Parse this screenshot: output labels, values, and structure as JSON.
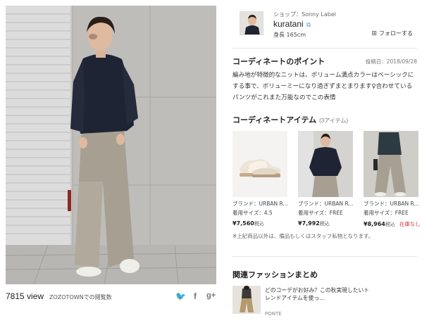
{
  "photo": {
    "alt": "woman in navy knit sweater and wide pants"
  },
  "stats": {
    "view_count": "7815 view",
    "view_note": "ZOZOTOWNでの閲覧数",
    "share_twitter_icon": "twitter-icon",
    "share_facebook_icon": "facebook-icon",
    "share_gplus_icon": "google-plus-icon",
    "share_twitter_glyph": "🐦",
    "share_facebook_glyph": "f",
    "share_gplus_glyph": "g+"
  },
  "profile": {
    "shop": "ショップ：Sonny Label",
    "name": "kuratani",
    "height": "身長 165cm",
    "follow_label": "フォローする"
  },
  "point": {
    "title": "コーディネートのポイント",
    "date": "投稿日：2018/09/28",
    "description": "編み地が特徴的なニットは、ボリューム満点カラーはベーシックにする事で、ボリューミーになり過ぎずまとまります♀合わせているパンツがこれまた万能なのでこの表情"
  },
  "items_section": {
    "title": "コーディネートアイテム",
    "count": "(3アイテム)",
    "items": [
      {
        "brand": "ブランド：URBAN R...",
        "size": "着用サイズ：4.5",
        "price": "¥7,560",
        "tax": "税込",
        "stock": ""
      },
      {
        "brand": "ブランド：URBAN R...",
        "size": "着用サイズ：FREE",
        "price": "¥7,992",
        "tax": "税込",
        "stock": ""
      },
      {
        "brand": "ブランド：URBAN R...",
        "size": "着用サイズ：FREE",
        "price": "¥8,964",
        "tax": "税込",
        "stock": "在庫なし"
      }
    ],
    "note": "※上記商品以外は、備品もしくはスタッフ私物となります。"
  },
  "related": {
    "title": "関連ファッションまとめ",
    "item_text": "どのコーデがお好み？この秋実現したいトレンドアイテムを使っ...",
    "item_source": "PONTE"
  },
  "colors": {
    "accent_link": "#49a3d8",
    "out_of_stock": "#d23c3c",
    "sweater_navy": "#1e2433"
  }
}
